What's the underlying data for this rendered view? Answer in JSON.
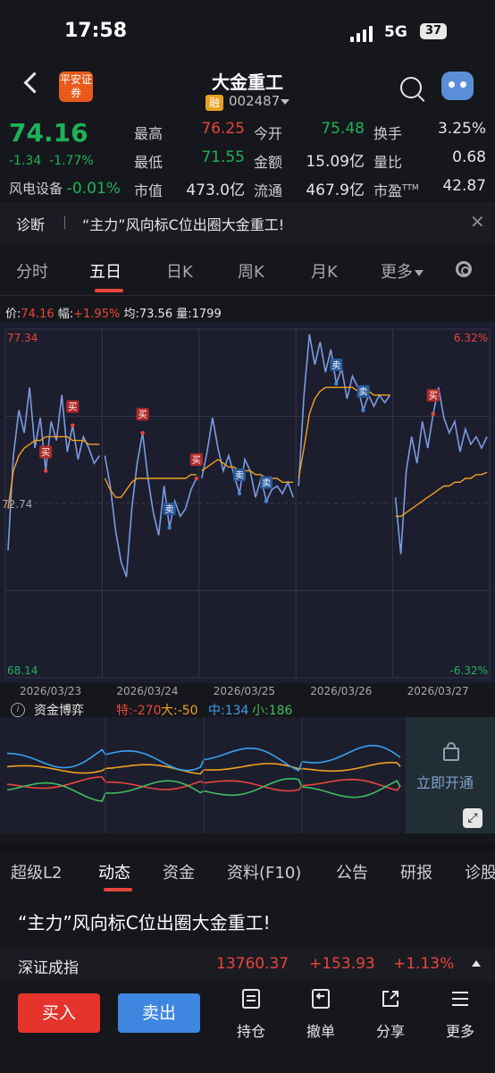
{
  "status_bar": {
    "time": "17:58",
    "network": "5G",
    "battery": "37"
  },
  "header": {
    "title": "大金重工",
    "badge": "融",
    "code": "002487",
    "broker_logo": "平安证券"
  },
  "quote": {
    "price": "74.16",
    "change": "-1.34",
    "change_pct": "-1.77%",
    "sector_name": "风电设备",
    "sector_change": "-0.01%",
    "fields": [
      {
        "label": "最高",
        "value": "76.25",
        "color": "red"
      },
      {
        "label": "今开",
        "value": "75.48",
        "color": "green"
      },
      {
        "label": "换手",
        "value": "3.25%",
        "color": "white"
      },
      {
        "label": "最低",
        "value": "71.55",
        "color": "green"
      },
      {
        "label": "金额",
        "value": "15.09亿",
        "color": "white"
      },
      {
        "label": "量比",
        "value": "0.68",
        "color": "white"
      },
      {
        "label": "市值",
        "value": "473.0亿",
        "color": "white"
      },
      {
        "label": "流通",
        "value": "467.9亿",
        "color": "white"
      },
      {
        "label": "市盈",
        "value": "42.87",
        "color": "white",
        "superscript": "TTM"
      }
    ]
  },
  "diagnosis": {
    "label": "诊断",
    "text": "“主力”风向标C位出圈大金重工!"
  },
  "chart_tabs": [
    "分时",
    "五日",
    "日K",
    "周K",
    "月K",
    "更多"
  ],
  "chart_info": {
    "price_label": "价:",
    "price": "74.16",
    "range_label": "幅:",
    "range": "+1.95%",
    "avg_label": "均:",
    "avg": "73.56",
    "vol_label": "量:",
    "vol": "1799"
  },
  "chart_data": {
    "type": "line",
    "x": [
      "2026/03/23",
      "2026/03/24",
      "2026/03/25",
      "2026/03/26",
      "2026/03/27"
    ],
    "ylim": [
      68.14,
      77.34
    ],
    "y_ticks": [
      "77.34",
      "72.74",
      "68.14"
    ],
    "right_ticks": [
      "6.32%",
      "-6.32%"
    ],
    "baseline": 72.74,
    "colors": {
      "price": "#7b9be0",
      "avg": "#f0a020"
    },
    "trade_marks": [
      {
        "day": 0,
        "label": "买"
      },
      {
        "day": 0,
        "label": "买"
      },
      {
        "day": 1,
        "label": "买"
      },
      {
        "day": 1,
        "label": "卖"
      },
      {
        "day": 1,
        "label": "买"
      },
      {
        "day": 2,
        "label": "卖"
      },
      {
        "day": 2,
        "label": "卖"
      },
      {
        "day": 3,
        "label": "卖"
      },
      {
        "day": 3,
        "label": "卖"
      },
      {
        "day": 4,
        "label": "买"
      }
    ],
    "days": [
      {
        "date": "2026/03/23",
        "price": [
          71.5,
          74.0,
          75.2,
          74.6,
          75.8,
          74.2,
          75.0,
          73.6,
          74.9,
          74.4,
          75.6,
          74.1,
          74.8,
          73.9,
          74.5,
          74.2,
          73.8,
          74.0
        ],
        "avg": [
          72.6,
          73.6,
          74.0,
          74.2,
          74.3,
          74.4,
          74.4,
          74.5,
          74.5,
          74.5,
          74.5,
          74.5,
          74.4,
          74.4,
          74.4,
          74.3,
          74.3,
          74.3
        ]
      },
      {
        "date": "2026/03/24",
        "price": [
          74.0,
          73.2,
          72.0,
          71.2,
          70.8,
          72.6,
          73.8,
          74.6,
          73.4,
          72.5,
          71.9,
          73.2,
          72.1,
          72.8,
          72.4,
          72.6,
          73.1,
          73.4
        ],
        "avg": [
          73.4,
          73.1,
          72.9,
          72.9,
          73.1,
          73.3,
          73.4,
          73.4,
          73.4,
          73.4,
          73.4,
          73.4,
          73.4,
          73.4,
          73.4,
          73.4,
          73.5,
          73.5
        ]
      },
      {
        "date": "2026/03/25",
        "price": [
          73.4,
          74.1,
          75.0,
          74.2,
          73.6,
          74.0,
          73.5,
          73.0,
          73.9,
          73.6,
          72.9,
          73.4,
          72.8,
          73.1,
          73.2,
          73.0,
          73.3,
          72.9
        ],
        "avg": [
          73.6,
          73.7,
          73.8,
          73.9,
          73.8,
          73.7,
          73.7,
          73.6,
          73.6,
          73.6,
          73.5,
          73.5,
          73.4,
          73.4,
          73.4,
          73.3,
          73.3,
          73.3
        ]
      },
      {
        "date": "2026/03/26",
        "price": [
          73.2,
          75.6,
          77.2,
          76.4,
          77.0,
          76.2,
          76.8,
          75.9,
          76.3,
          75.5,
          76.1,
          75.8,
          75.2,
          75.6,
          75.3,
          75.6,
          75.4,
          75.6
        ],
        "avg": [
          73.4,
          74.2,
          75.1,
          75.5,
          75.7,
          75.8,
          75.8,
          75.8,
          75.8,
          75.8,
          75.8,
          75.7,
          75.7,
          75.7,
          75.6,
          75.6,
          75.6,
          75.6
        ]
      },
      {
        "date": "2026/03/27",
        "price": [
          72.9,
          71.4,
          73.6,
          74.5,
          73.8,
          74.9,
          74.2,
          75.1,
          75.8,
          75.0,
          74.6,
          74.9,
          74.1,
          74.7,
          74.3,
          74.5,
          74.2,
          74.5
        ],
        "avg": [
          72.4,
          72.4,
          72.5,
          72.6,
          72.7,
          72.8,
          72.9,
          73.0,
          73.1,
          73.2,
          73.2,
          73.3,
          73.3,
          73.4,
          73.4,
          73.5,
          73.5,
          73.56
        ]
      }
    ]
  },
  "capital_game": {
    "title": "资金博弈",
    "items": [
      {
        "label": "特:",
        "value": "-270",
        "color": "#e8453c"
      },
      {
        "label": "大:",
        "value": "-50",
        "color": "#f0a020"
      },
      {
        "label": "中:",
        "value": "134",
        "color": "#3aa0f0"
      },
      {
        "label": "小:",
        "value": "186",
        "color": "#3fbf5f"
      }
    ],
    "unlock_text": "立即开通"
  },
  "bottom_tabs": [
    "超级L2",
    "动态",
    "资金",
    "资料(F10)",
    "公告",
    "研报",
    "诊股"
  ],
  "news_headline": "“主力”风向标C位出圈大金重工!",
  "index": {
    "name": "深证成指",
    "value": "13760.37",
    "change": "+153.93",
    "pct": "+1.13%"
  },
  "footer": {
    "buy": "买入",
    "sell": "卖出",
    "items": [
      {
        "label": "持仓",
        "icon": "holdings-icon"
      },
      {
        "label": "撤单",
        "icon": "cancel-order-icon"
      },
      {
        "label": "分享",
        "icon": "share-icon"
      },
      {
        "label": "更多",
        "icon": "more-menu-icon"
      }
    ]
  }
}
